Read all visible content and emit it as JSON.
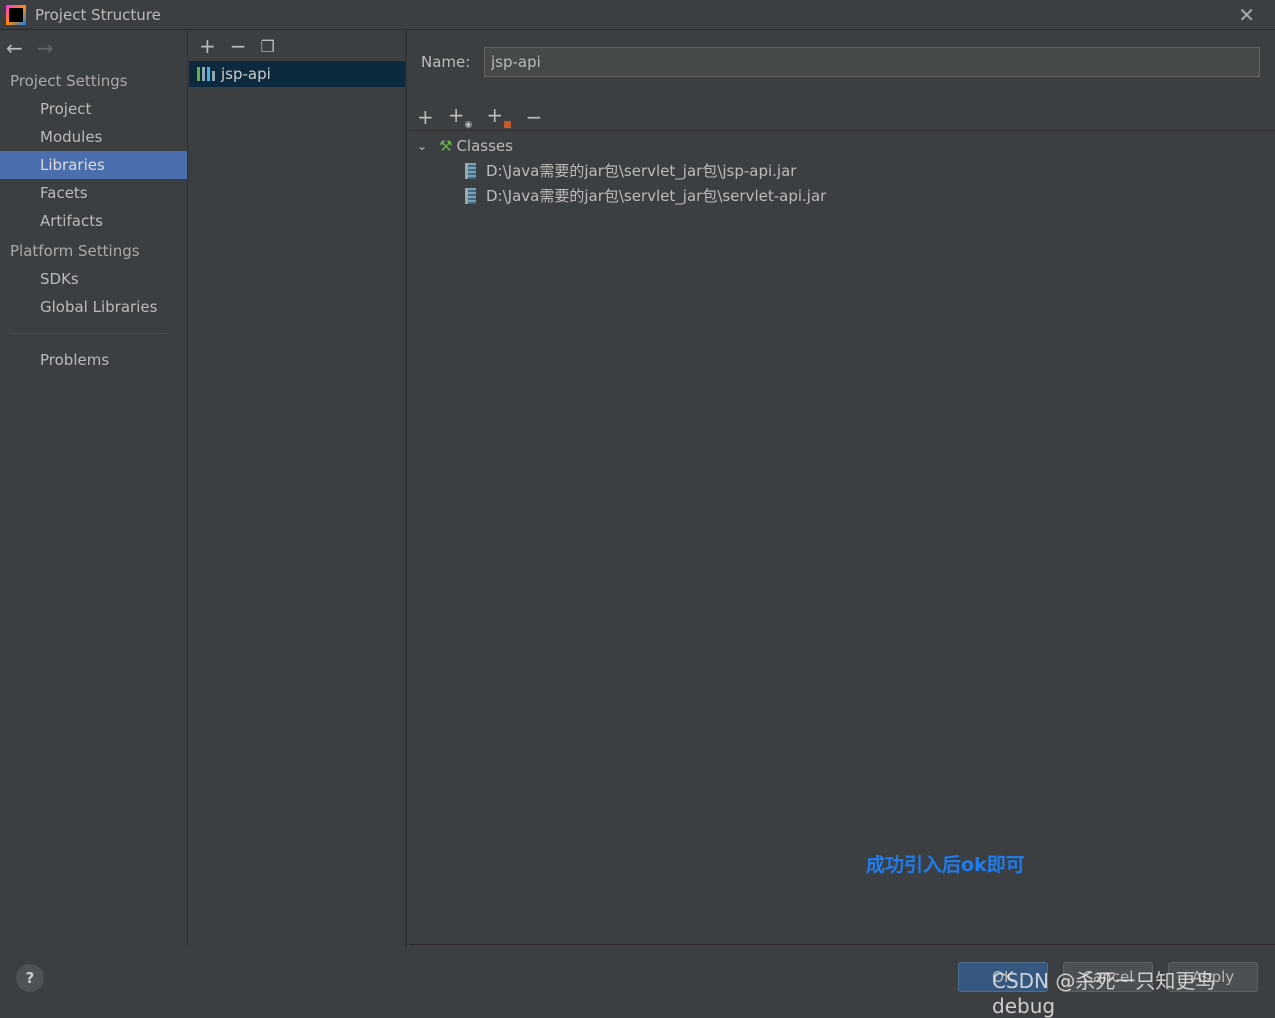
{
  "window": {
    "title": "Project Structure"
  },
  "sidebar": {
    "groups": [
      "Project Settings",
      "Platform Settings"
    ],
    "project_items": [
      "Project",
      "Modules",
      "Libraries",
      "Facets",
      "Artifacts"
    ],
    "platform_items": [
      "SDKs",
      "Global Libraries"
    ],
    "problems": "Problems",
    "selected": "Libraries"
  },
  "libraries": {
    "items": [
      {
        "label": "jsp-api"
      }
    ]
  },
  "detail": {
    "name_label": "Name:",
    "name_value": "jsp-api",
    "classes_label": "Classes",
    "paths": [
      "D:\\Java需要的jar包\\servlet_jar包\\jsp-api.jar",
      "D:\\Java需要的jar包\\servlet_jar包\\servlet-api.jar"
    ]
  },
  "annotation": "成功引入后ok即可",
  "footer": {
    "ok": "OK",
    "cancel": "Cancel",
    "apply": "Apply",
    "help": "?"
  },
  "watermark": "CSDN @杀死一只知更鸟debug",
  "colors": {
    "selection": "#4b6eaf",
    "annotation": "#1e7df0",
    "ok_button": "#365880"
  }
}
